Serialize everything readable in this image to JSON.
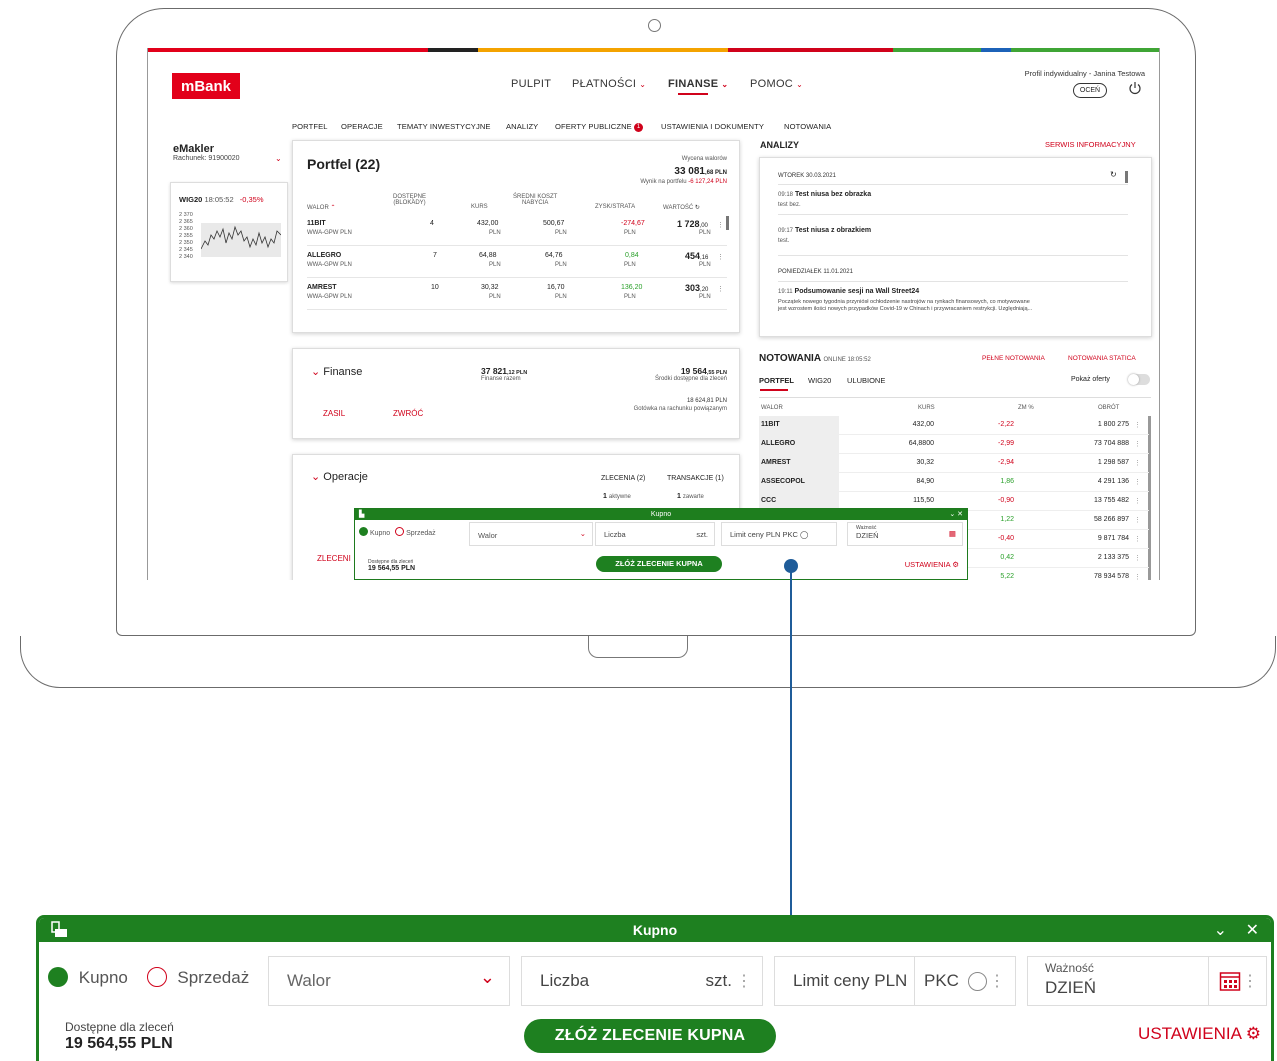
{
  "header": {
    "logo": "mBank",
    "nav": [
      {
        "label": "PULPIT"
      },
      {
        "label": "PŁATNOŚCI"
      },
      {
        "label": "FINANSE"
      },
      {
        "label": "POMOC"
      }
    ],
    "profile_text": "Profil indywidualny - Janina Testowa",
    "ocen_label": "OCEŃ"
  },
  "subnav": {
    "items": [
      "PORTFEL",
      "OPERACJE",
      "TEMATY INWESTYCYJNE",
      "ANALIZY",
      "OFERTY PUBLICZNE",
      "USTAWIENIA I DOKUMENTY",
      "NOTOWANIA"
    ],
    "badge": "1"
  },
  "sidebar": {
    "title": "eMakler",
    "account": "Rachunek: 91900020",
    "wig": {
      "name": "WIG20",
      "time": "18:05:52",
      "change": "-0,35%",
      "ticks": [
        "2 370",
        "2 365",
        "2 360",
        "2 355",
        "2 350",
        "2 345",
        "2 340"
      ]
    }
  },
  "portfel": {
    "title": "Portfel (22)",
    "valuation_label": "Wycena walorów",
    "valuation_value": "33 081",
    "valuation_dec": ",68 PLN",
    "result_label": "Wynik na portfelu",
    "result_value": "-6 127,24 PLN",
    "columns": {
      "walor": "WALOR",
      "dostepne": "DOSTĘPNE",
      "blokady": "(BLOKADY)",
      "kurs": "KURS",
      "sredni1": "ŚREDNI KOSZT",
      "sredni2": "NABYCIA",
      "zysk": "ZYSK/STRATA",
      "wartosc": "WARTOŚĆ"
    },
    "rows": [
      {
        "name": "11BIT",
        "market": "WWA-GPW PLN",
        "qty": "4",
        "kurs": "432,00",
        "cost": "500,67",
        "pl": "-274,67",
        "value": "1 728",
        "value_dec": ",00",
        "pl_color": "red"
      },
      {
        "name": "ALLEGRO",
        "market": "WWA-GPW PLN",
        "qty": "7",
        "kurs": "64,88",
        "cost": "64,76",
        "pl": "0,84",
        "value": "454",
        "value_dec": ",16",
        "pl_color": "green"
      },
      {
        "name": "AMREST",
        "market": "WWA-GPW PLN",
        "qty": "10",
        "kurs": "30,32",
        "cost": "16,70",
        "pl": "136,20",
        "value": "303",
        "value_dec": ",20",
        "pl_color": "green"
      }
    ],
    "unit": "PLN"
  },
  "analizy": {
    "title": "ANALIZY",
    "link": "SERWIS INFORMACYJNY",
    "day1": "WTOREK 30.03.2021",
    "items1": [
      {
        "time": "09:18",
        "title": "Test niusa bez obrazka",
        "body": "test bez."
      },
      {
        "time": "09:17",
        "title": "Test niusa z obrazkiem",
        "body": "test."
      }
    ],
    "day2": "PONIEDZIAŁEK 11.01.2021",
    "item3": {
      "time": "19:11",
      "title": "Podsumowanie sesji na Wall Street24",
      "body1": "Początek nowego tygodnia przyniósł ochłodzenie nastrojów na rynkach finansowych, co motywowane",
      "body2": "jest wzrostem ilości nowych przypadków Covid-19 w Chinach i przywracaniem restrykcji. Uzględniają..."
    }
  },
  "finanse": {
    "title": "Finanse",
    "total_value": "37 821",
    "total_dec": ",12 PLN",
    "total_label": "Finanse razem",
    "available_value": "19 564",
    "available_dec": ",55 PLN",
    "available_label": "Środki dostępne dla zleceń",
    "cash_value": "18 624",
    "cash_dec": ",81 PLN",
    "cash_label": "Gotówka na rachunku powiązanym",
    "btn_zasil": "ZASIL",
    "btn_zwroc": "ZWRÓĆ"
  },
  "operacje": {
    "title": "Operacje",
    "zlecenia": "ZLECENIA (2)",
    "transakcje": "TRANSAKCJE (1)",
    "aktywne_num": "1",
    "aktywne_label": "aktywne",
    "zawarte_num": "1",
    "zawarte_label": "zawarte",
    "link": "ZLECENI"
  },
  "notowania": {
    "title": "NOTOWANIA",
    "online": "ONLINE 18:05:52",
    "link1": "PEŁNE NOTOWANIA",
    "link2": "NOTOWANIA STATICA",
    "tabs": [
      "PORTFEL",
      "WIG20",
      "ULUBIONE"
    ],
    "show_offers": "Pokaż oferty",
    "columns": {
      "walor": "WALOR",
      "kurs": "KURS",
      "zm": "ZM %",
      "obrot": "OBRÓT"
    },
    "rows": [
      {
        "name": "11BIT",
        "kurs": "432,00",
        "zm": "-2,22",
        "obrot": "1 800 275",
        "c": "red"
      },
      {
        "name": "ALLEGRO",
        "kurs": "64,8800",
        "zm": "-2,99",
        "obrot": "73 704 888",
        "c": "red"
      },
      {
        "name": "AMREST",
        "kurs": "30,32",
        "zm": "-2,94",
        "obrot": "1 298 587",
        "c": "red"
      },
      {
        "name": "ASSECOPOL",
        "kurs": "84,90",
        "zm": "1,86",
        "obrot": "4 291 136",
        "c": "green"
      },
      {
        "name": "CCC",
        "kurs": "115,50",
        "zm": "-0,90",
        "obrot": "13 755 482",
        "c": "red"
      },
      {
        "name": "",
        "kurs": "",
        "zm": "1,22",
        "obrot": "58 266 897",
        "c": "green"
      },
      {
        "name": "",
        "kurs": "",
        "zm": "-0,40",
        "obrot": "9 871 784",
        "c": "red"
      },
      {
        "name": "",
        "kurs": "",
        "zm": "0,42",
        "obrot": "2 133 375",
        "c": "green"
      },
      {
        "name": "",
        "kurs": "",
        "zm": "5,22",
        "obrot": "78 934 578",
        "c": "green"
      }
    ]
  },
  "order": {
    "title": "Kupno",
    "buy": "Kupno",
    "sell": "Sprzedaż",
    "walor_placeholder": "Walor",
    "liczba": "Liczba",
    "unit": "szt.",
    "limit": "Limit ceny PLN",
    "pkc": "PKC",
    "waznosc_label": "Ważność",
    "waznosc_value": "DZIEŃ",
    "available_label": "Dostępne dla zleceń",
    "available_value": "19 564,55 PLN",
    "submit": "ZŁÓŻ ZLECENIE KUPNA",
    "settings": "USTAWIENIA"
  },
  "colors": {
    "brand_red": "#d0021b",
    "green": "#1e8020",
    "connector": "#1f5c99"
  }
}
